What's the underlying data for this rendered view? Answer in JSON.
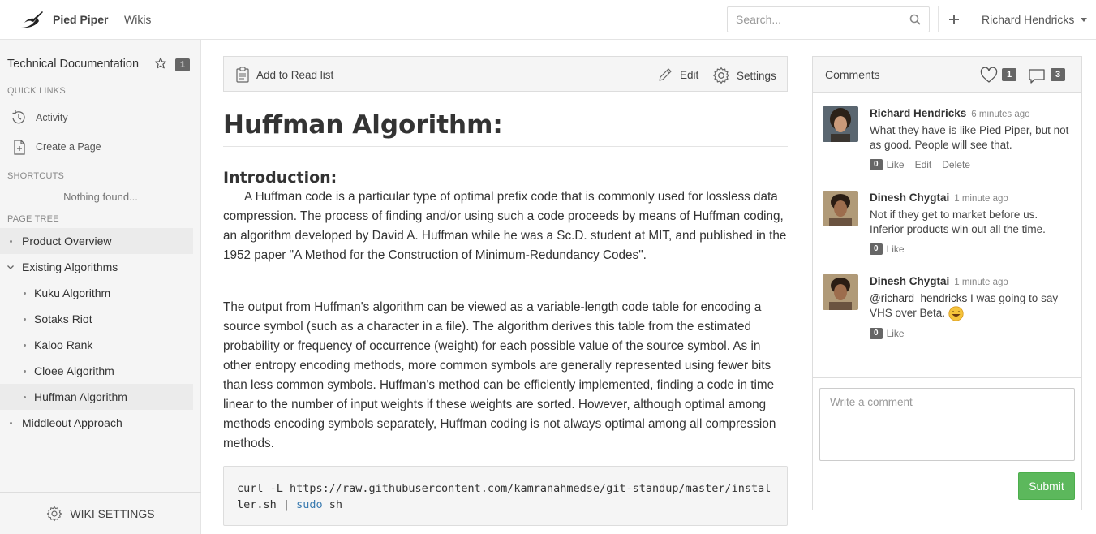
{
  "header": {
    "brand": "Pied Piper",
    "nav_wikis": "Wikis",
    "search_placeholder": "Search...",
    "user_name": "Richard Hendricks",
    "logo_icon": "pied-piper-logo"
  },
  "sidebar": {
    "wiki_title": "Technical Documentation",
    "star_count": "1",
    "quick_links_head": "QUICK LINKS",
    "quick_links": [
      {
        "label": "Activity",
        "icon": "history-icon"
      },
      {
        "label": "Create a Page",
        "icon": "add-page-icon"
      }
    ],
    "shortcuts_head": "SHORTCUTS",
    "shortcuts_empty": "Nothing found...",
    "page_tree_head": "PAGE TREE",
    "tree": [
      {
        "label": "Product Overview"
      },
      {
        "label": "Existing Algorithms"
      },
      {
        "label": "Kuku Algorithm"
      },
      {
        "label": "Sotaks Riot"
      },
      {
        "label": "Kaloo Rank"
      },
      {
        "label": "Cloee Algorithm"
      },
      {
        "label": "Huffman Algorithm"
      },
      {
        "label": "Middleout Approach"
      }
    ],
    "wiki_settings": "WIKI SETTINGS"
  },
  "toolbar": {
    "read_list": "Add to Read list",
    "edit": "Edit",
    "settings": "Settings"
  },
  "article": {
    "title": "Huffman Algorithm:",
    "intro_heading": "Introduction:",
    "para1": "A Huffman code is a particular type of optimal prefix code that is commonly used for lossless data compression. The process of finding and/or using such a code proceeds by means of Huffman coding, an algorithm developed by David A. Huffman while he was a Sc.D. student at MIT, and published in the 1952 paper \"A Method for the Construction of Minimum-Redundancy Codes\".",
    "para2": "The output from Huffman's algorithm can be viewed as a variable-length code table for encoding a source symbol (such as a character in a file). The algorithm derives this table from the estimated probability or frequency of occurrence (weight) for each possible value of the source symbol. As in other entropy encoding methods, more common symbols are generally represented using fewer bits than less common symbols. Huffman's method can be efficiently implemented, finding a code in time linear to the number of input weights if these weights are sorted. However, although optimal among methods encoding symbols separately, Huffman coding is not always optimal among all compression methods.",
    "code_main": "curl -L https://raw.githubusercontent.com/kamranahmedse/git-standup/master/installer.sh | ",
    "code_kw": "sudo",
    "code_tail": " sh"
  },
  "comments": {
    "title": "Comments",
    "like_count": "1",
    "comment_count": "3",
    "items": [
      {
        "name": "Richard Hendricks",
        "time": "6 minutes ago",
        "text": "What they have is like Pied Piper, but not as good. People will see that.",
        "likes": "0",
        "like_label": "Like",
        "edit_label": "Edit",
        "delete_label": "Delete"
      },
      {
        "name": "Dinesh Chygtai",
        "time": "1 minute ago",
        "text": "Not if they get to market before us. Inferior products win out all the time.",
        "likes": "0",
        "like_label": "Like"
      },
      {
        "name": "Dinesh Chygtai",
        "time": "1 minute ago",
        "mention": "@richard_hendricks",
        "text": " I was going to say VHS over Beta.",
        "likes": "0",
        "like_label": "Like"
      }
    ],
    "input_placeholder": "Write a comment",
    "submit": "Submit"
  },
  "colors": {
    "submit_green": "#5cb85c",
    "badge_gray": "#666666",
    "code_keyword": "#3a7bb0"
  }
}
